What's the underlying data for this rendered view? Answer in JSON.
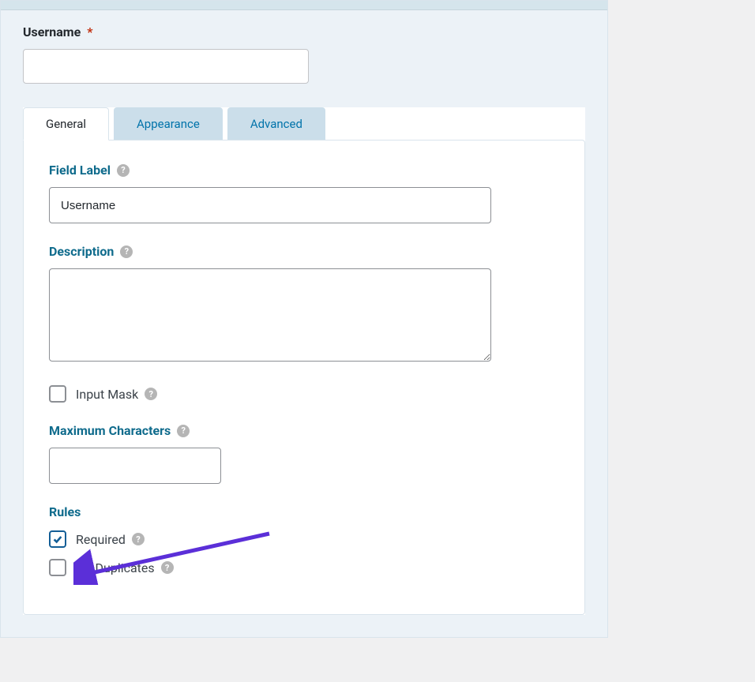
{
  "preview": {
    "label": "Username",
    "required_mark": "*"
  },
  "tabs": {
    "general": "General",
    "appearance": "Appearance",
    "advanced": "Advanced"
  },
  "fields": {
    "field_label": {
      "label": "Field Label",
      "value": "Username"
    },
    "description": {
      "label": "Description",
      "value": ""
    },
    "input_mask": {
      "label": "Input Mask",
      "checked": false
    },
    "max_chars": {
      "label": "Maximum Characters",
      "value": ""
    },
    "rules": {
      "label": "Rules",
      "required": {
        "label": "Required",
        "checked": true
      },
      "no_duplicates": {
        "label": "No Duplicates",
        "checked": false
      }
    }
  },
  "colors": {
    "teal": "#0f6b8c",
    "arrow": "#5b2fd8"
  }
}
